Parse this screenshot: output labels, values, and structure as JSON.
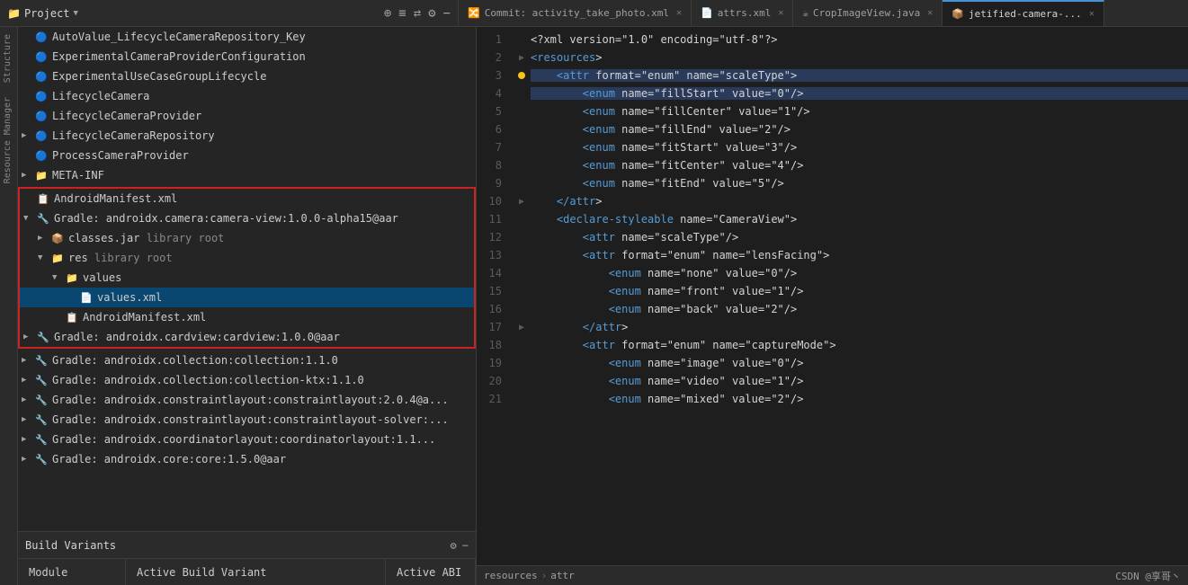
{
  "topBar": {
    "projectTitle": "Project",
    "icons": [
      "⊕",
      "≡",
      "⇄",
      "⚙",
      "−"
    ]
  },
  "tabs": [
    {
      "id": "commit",
      "icon": "🔀",
      "label": "Commit: activity_take_photo.xml",
      "active": false
    },
    {
      "id": "attrs",
      "icon": "📄",
      "label": "attrs.xml",
      "active": false
    },
    {
      "id": "cropimage",
      "icon": "☕",
      "label": "CropImageView.java",
      "active": false
    },
    {
      "id": "jetified",
      "icon": "📦",
      "label": "jetified-camera-...",
      "active": true
    }
  ],
  "sidebar": {
    "title": "Project",
    "arrow": "▼"
  },
  "treeItems": [
    {
      "indent": 0,
      "icon": "🔵",
      "label": "AutoValue_LifecycleCameraRepository_Key",
      "type": "class"
    },
    {
      "indent": 0,
      "icon": "🔵",
      "label": "ExperimentalCameraProviderConfiguration",
      "type": "class"
    },
    {
      "indent": 0,
      "icon": "🔵",
      "label": "ExperimentalUseCaseGroupLifecycle",
      "type": "class"
    },
    {
      "indent": 0,
      "icon": "🔵",
      "label": "LifecycleCamera",
      "type": "class"
    },
    {
      "indent": 0,
      "icon": "🔵",
      "label": "LifecycleCameraProvider",
      "type": "class"
    },
    {
      "indent": 0,
      "arrow": "▶",
      "icon": "🔵",
      "label": "LifecycleCameraRepository",
      "type": "class"
    },
    {
      "indent": 0,
      "icon": "🔵",
      "label": "ProcessCameraProvider",
      "type": "class"
    },
    {
      "indent": 0,
      "arrow": "▶",
      "icon": "📁",
      "label": "META-INF",
      "type": "folder"
    }
  ],
  "redBorderItems": [
    {
      "indent": 0,
      "icon": "📄",
      "label": "AndroidManifest.xml",
      "type": "manifest",
      "tag": true
    },
    {
      "indent": 0,
      "arrow": "▼",
      "icon": "📦",
      "label": "Gradle: androidx.camera:camera-view:1.0.0-alpha15@aar",
      "type": "gradle"
    },
    {
      "indent": 1,
      "arrow": "▶",
      "icon": "📦",
      "label": "classes.jar",
      "sublabel": "library root",
      "type": "jar"
    },
    {
      "indent": 1,
      "arrow": "▼",
      "icon": "📁",
      "label": "res",
      "sublabel": "library root",
      "type": "folder"
    },
    {
      "indent": 2,
      "arrow": "▼",
      "icon": "📁",
      "label": "values",
      "type": "folder"
    },
    {
      "indent": 3,
      "icon": "📄",
      "label": "values.xml",
      "type": "xml",
      "selected": true
    },
    {
      "indent": 2,
      "icon": "📄",
      "label": "AndroidManifest.xml",
      "type": "manifest",
      "tag": true
    },
    {
      "indent": 0,
      "arrow": "▶",
      "icon": "📦",
      "label": "Gradle: androidx.cardview:cardview:1.0.0@aar",
      "type": "gradle"
    }
  ],
  "afterRedItems": [
    {
      "arrow": "▶",
      "icon": "📦",
      "label": "Gradle: androidx.collection:collection:1.1.0",
      "type": "gradle"
    },
    {
      "arrow": "▶",
      "icon": "📦",
      "label": "Gradle: androidx.collection:collection-ktx:1.1.0",
      "type": "gradle"
    },
    {
      "arrow": "▶",
      "icon": "📦",
      "label": "Gradle: androidx.constraintlayout:constraintlayout:2.0.4@a...",
      "type": "gradle"
    },
    {
      "arrow": "▶",
      "icon": "📦",
      "label": "Gradle: androidx.constraintlayout:constraintlayout-solver:...",
      "type": "gradle"
    },
    {
      "arrow": "▶",
      "icon": "📦",
      "label": "Gradle: androidx.coordinatorlayout:coordinatorlayout:1.1...",
      "type": "gradle"
    },
    {
      "arrow": "▶",
      "icon": "📦",
      "label": "Gradle: androidx.core:core:1.5.0@aar",
      "type": "gradle"
    }
  ],
  "buildVariants": {
    "title": "Build Variants",
    "icons": [
      "⚙",
      "−"
    ],
    "columns": [
      "Module",
      "Active Build Variant",
      "Active ABI"
    ]
  },
  "codeLines": [
    {
      "num": 1,
      "gutter": "",
      "text": "<?xml version=\"1.0\" encoding=\"utf-8\"?>"
    },
    {
      "num": 2,
      "gutter": "arrow",
      "text": "<resources>"
    },
    {
      "num": 3,
      "gutter": "dot",
      "text": "    <attr format=\"enum\" name=\"scaleType\">",
      "highlight": true
    },
    {
      "num": 4,
      "gutter": "",
      "text": "        <enum name=\"fillStart\" value=\"0\"/>",
      "highlight": true
    },
    {
      "num": 5,
      "gutter": "",
      "text": "        <enum name=\"fillCenter\" value=\"1\"/>"
    },
    {
      "num": 6,
      "gutter": "",
      "text": "        <enum name=\"fillEnd\" value=\"2\"/>"
    },
    {
      "num": 7,
      "gutter": "",
      "text": "        <enum name=\"fitStart\" value=\"3\"/>"
    },
    {
      "num": 8,
      "gutter": "",
      "text": "        <enum name=\"fitCenter\" value=\"4\"/>"
    },
    {
      "num": 9,
      "gutter": "",
      "text": "        <enum name=\"fitEnd\" value=\"5\"/>"
    },
    {
      "num": 10,
      "gutter": "arrow",
      "text": "    </attr>"
    },
    {
      "num": 11,
      "gutter": "",
      "text": "    <declare-styleable name=\"CameraView\">"
    },
    {
      "num": 12,
      "gutter": "",
      "text": "        <attr name=\"scaleType\"/>"
    },
    {
      "num": 13,
      "gutter": "",
      "text": "        <attr format=\"enum\" name=\"lensFacing\">"
    },
    {
      "num": 14,
      "gutter": "",
      "text": "            <enum name=\"none\" value=\"0\"/>"
    },
    {
      "num": 15,
      "gutter": "",
      "text": "            <enum name=\"front\" value=\"1\"/>"
    },
    {
      "num": 16,
      "gutter": "",
      "text": "            <enum name=\"back\" value=\"2\"/>"
    },
    {
      "num": 17,
      "gutter": "arrow",
      "text": "        </attr>"
    },
    {
      "num": 18,
      "gutter": "",
      "text": "        <attr format=\"enum\" name=\"captureMode\">"
    },
    {
      "num": 19,
      "gutter": "",
      "text": "            <enum name=\"image\" value=\"0\"/>"
    },
    {
      "num": 20,
      "gutter": "",
      "text": "            <enum name=\"video\" value=\"1\"/>"
    },
    {
      "num": 21,
      "gutter": "",
      "text": "            <enum name=\"mixed\" value=\"2\"/>"
    }
  ],
  "breadcrumb": {
    "path": [
      "resources",
      "attr"
    ]
  },
  "statusBar": {
    "rightText": "CSDN @享哥丶"
  }
}
